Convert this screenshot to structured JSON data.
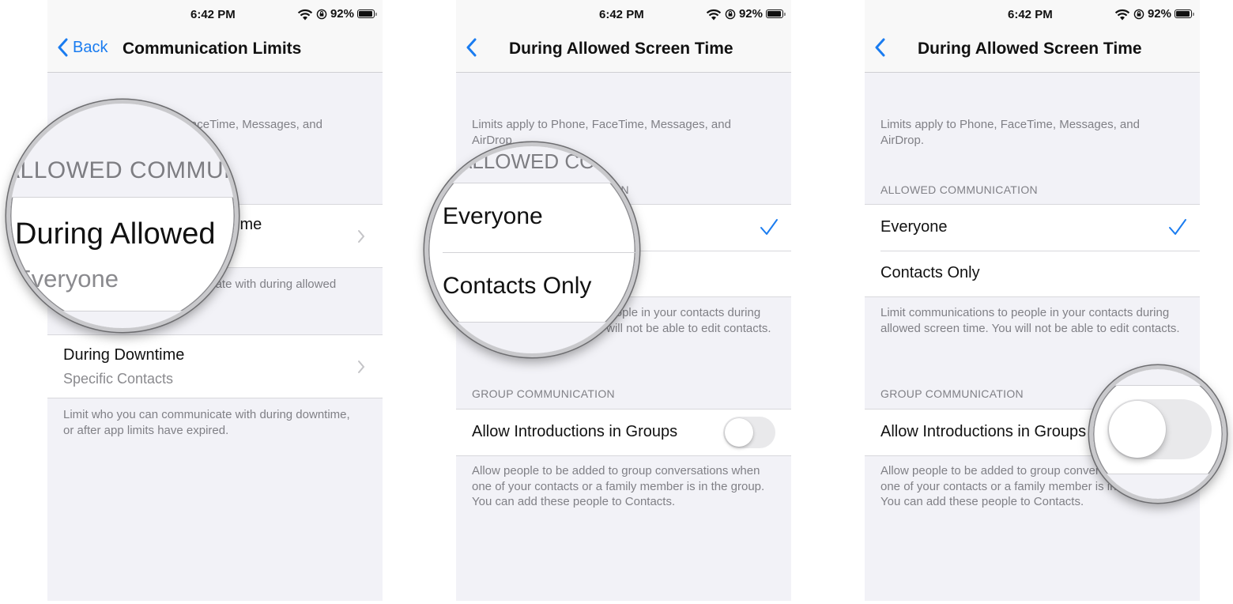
{
  "status_bar": {
    "time": "6:42 PM",
    "battery": "92%",
    "battery_level": 0.92
  },
  "colors": {
    "accent": "#1a7cf0",
    "background": "#f2f2f7",
    "secondary_text": "#808086"
  },
  "screen1": {
    "back_label": "Back",
    "title": "Communication Limits",
    "intro": "Limits apply to Phone, FaceTime, Messages, and AirDrop.",
    "section_header": "ALLOWED COMMUNICATION",
    "rows": [
      {
        "title": "During Allowed Screen Time",
        "subtitle": "Everyone"
      },
      {
        "title": "During Downtime",
        "subtitle": "Specific Contacts"
      }
    ],
    "row1_footer": "Limit who you can communicate with during allowed screen time.",
    "row2_footer": "Limit who you can communicate with during downtime, or after app limits have expired.",
    "magnifier": {
      "header": "ALLOWED COMMUNICATION",
      "title": "During Allowed",
      "subtitle": "Everyone"
    }
  },
  "screen2": {
    "title": "During Allowed Screen Time",
    "intro": "Limits apply to Phone, FaceTime, Messages, and AirDrop.",
    "section_header": "ALLOWED COMMUNICATION",
    "options": [
      {
        "label": "Everyone",
        "selected": true
      },
      {
        "label": "Contacts Only",
        "selected": false
      }
    ],
    "options_footer": "Limit communications to people in your contacts during allowed screen time. You will not be able to edit contacts.",
    "group_header": "GROUP COMMUNICATION",
    "toggle_label": "Allow Introductions in Groups",
    "toggle_on": false,
    "group_footer": "Allow people to be added to group conversations when one of your contacts or a family member is in the group. You can add these people to Contacts.",
    "magnifier": {
      "header": "ALLOWED COMMUNICATION",
      "option1": "Everyone",
      "option2": "Contacts Only"
    }
  },
  "screen3": {
    "title": "During Allowed Screen Time",
    "intro": "Limits apply to Phone, FaceTime, Messages, and AirDrop.",
    "section_header": "ALLOWED COMMUNICATION",
    "options": [
      {
        "label": "Everyone",
        "selected": true
      },
      {
        "label": "Contacts Only",
        "selected": false
      }
    ],
    "options_footer": "Limit communications to people in your contacts during allowed screen time. You will not be able to edit contacts.",
    "group_header": "GROUP COMMUNICATION",
    "toggle_label": "Allow Introductions in Groups",
    "toggle_on": false,
    "group_footer": "Allow people to be added to group conversations when one of your contacts or a family member is in the group. You can add these people to Contacts."
  }
}
